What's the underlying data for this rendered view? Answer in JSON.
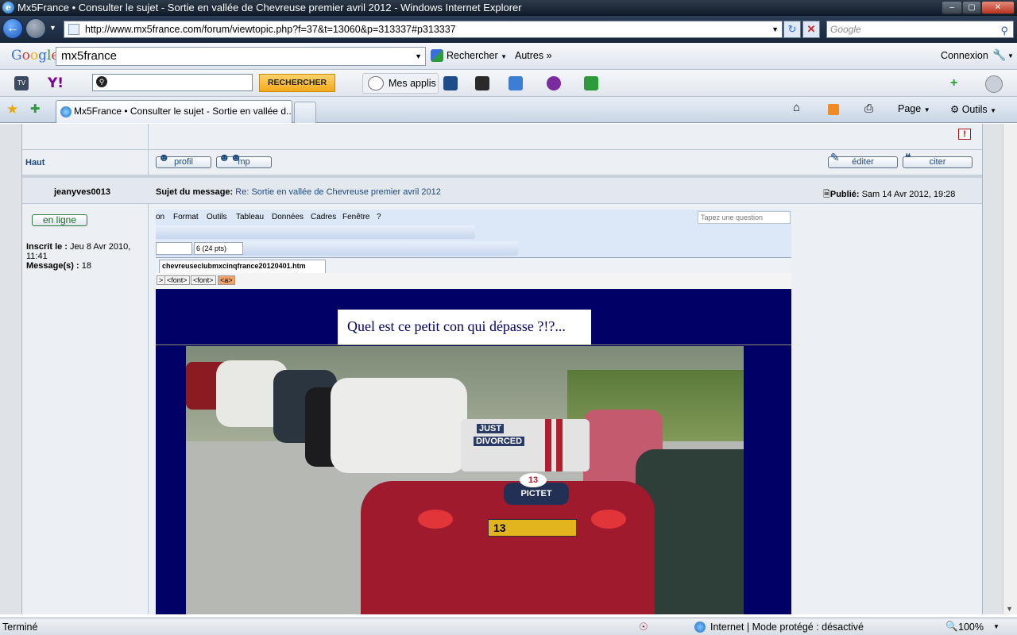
{
  "window": {
    "title": "Mx5France • Consulter le sujet - Sortie en vallée de Chevreuse premier avril 2012 - Windows Internet Explorer"
  },
  "address_bar": {
    "url": "http://www.mx5france.com/forum/viewtopic.php?f=37&t=13060&p=313337#p313337",
    "search_placeholder": "Google"
  },
  "google_toolbar": {
    "logo": "Google",
    "query": "mx5france",
    "search_label": "Rechercher",
    "more_label": "Autres",
    "login_label": "Connexion"
  },
  "yahoo_toolbar": {
    "search_button": "RECHERCHER",
    "apps_label": "Mes applis"
  },
  "tabs": [
    {
      "label": "Mx5France • Consulter le sujet - Sortie en vallée d..."
    }
  ],
  "command_bar": {
    "page_label": "Page",
    "tools_label": "Outils"
  },
  "post_prev": {
    "top_link": "Haut",
    "profile_button": "profil",
    "pm_button": "mp",
    "edit_button": "éditer",
    "quote_button": "citer"
  },
  "post": {
    "author": "jeanyves0013",
    "subject_label": "Sujet du message:",
    "subject": "Re: Sortie en vallée de Chevreuse premier avril 2012",
    "published_label": "Publié:",
    "published": "Sam 14 Avr 2012, 19:28",
    "online_label": "en ligne",
    "joined_label": "Inscrit le :",
    "joined_value": "Jeu 8 Avr 2010, 11:41",
    "messages_label": "Message(s) :",
    "messages_value": "18"
  },
  "embedded_editor": {
    "menu": [
      "on",
      "Format",
      "Outils",
      "Tableau",
      "Données",
      "Cadres",
      "Fenêtre",
      "?"
    ],
    "question_placeholder": "Tapez une question",
    "font_size": "6 (24 pts)",
    "file_tab": "chevreuseclubmxcinqfrance20120401.htm",
    "tags": [
      ">",
      "<font>",
      "<font>",
      "<a>"
    ],
    "caption": "Quel est ce petit con qui dépasse ?!?..."
  },
  "photo": {
    "sign_line1": "JUST",
    "sign_line2": "DIVORCED",
    "plate": "13",
    "badge": "PICTET",
    "badge_num": "13"
  },
  "status_bar": {
    "left": "Terminé",
    "zone": "Internet | Mode protégé : désactivé",
    "zoom": "100%"
  },
  "colors": {
    "post_bg": "#000066",
    "forum_link": "#1c4a80"
  }
}
